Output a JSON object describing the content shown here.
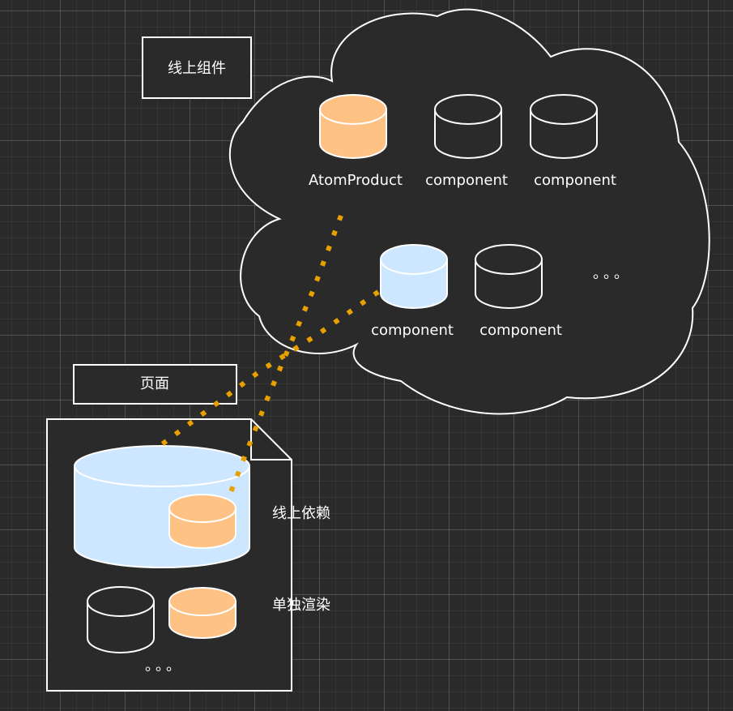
{
  "colors": {
    "background": "#2a2a2a",
    "stroke": "#ffffff",
    "orange_fill": "#ffc285",
    "blue_fill": "#cce7ff",
    "connector": "#e8a000",
    "shape_fill": "#2a2a2a"
  },
  "boxes": {
    "online_components": "线上组件",
    "page": "页面"
  },
  "cloud": {
    "items": [
      {
        "label": "AtomProduct",
        "fill": "orange"
      },
      {
        "label": "component",
        "fill": "none"
      },
      {
        "label": "component",
        "fill": "none"
      },
      {
        "label": "component",
        "fill": "blue"
      },
      {
        "label": "component",
        "fill": "none"
      }
    ],
    "ellipsis": "。。。"
  },
  "document": {
    "labels": {
      "online_dependency": "线上依赖",
      "standalone_render": "单独渲染"
    },
    "ellipsis": "。。。"
  }
}
